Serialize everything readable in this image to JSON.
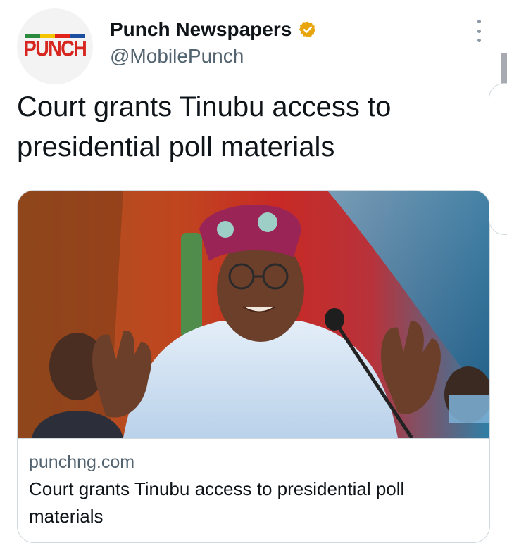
{
  "account": {
    "name": "Punch Newspapers",
    "handle": "@MobilePunch",
    "verified_color": "#e8a50c",
    "avatar_logo": "PUNCH",
    "brand_color": "#d7261f"
  },
  "tweet": {
    "text": "Court grants Tinubu access to presidential poll materials"
  },
  "card": {
    "domain": "punchng.com",
    "title": "Court grants Tinubu access to presidential poll materials",
    "image_description_icon": "photo"
  },
  "icons": {
    "more": "more-options-icon",
    "verified": "verified-badge-icon"
  }
}
